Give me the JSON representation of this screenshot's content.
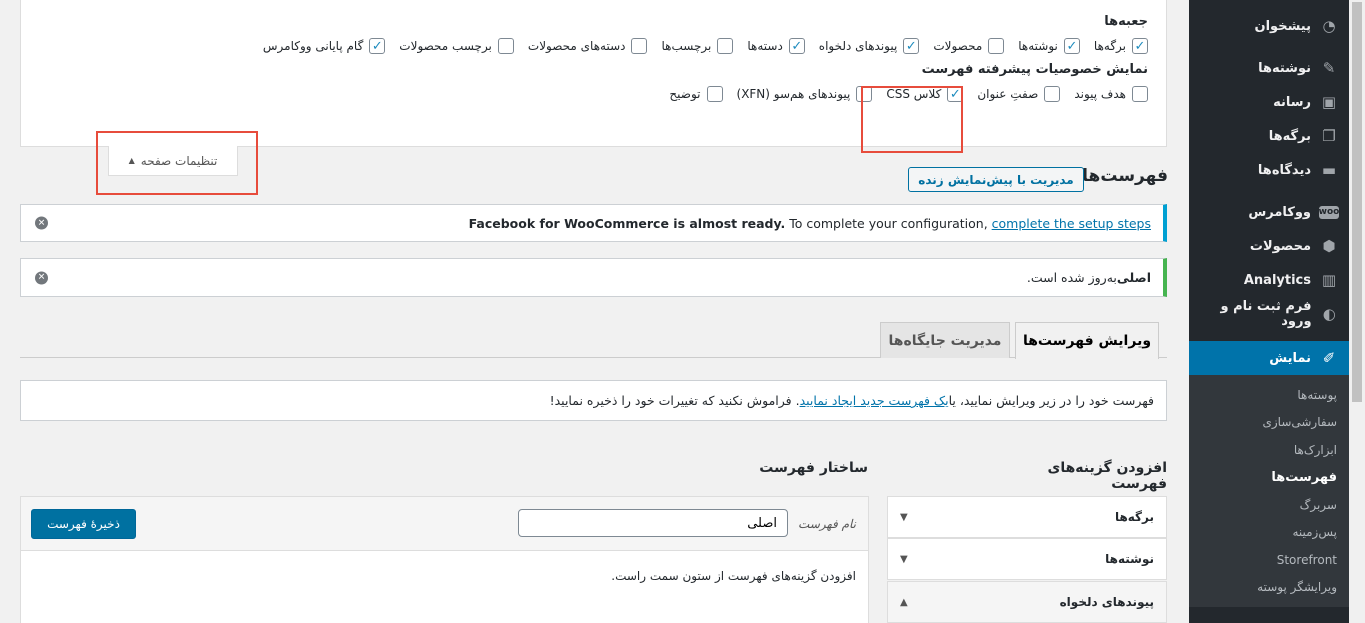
{
  "sidebar": {
    "items": [
      {
        "label": "پیشخوان",
        "icon": "dashboard-icon"
      },
      {
        "label": "نوشته‌ها",
        "icon": "pin-icon"
      },
      {
        "label": "رسانه",
        "icon": "media-icon"
      },
      {
        "label": "برگه‌ها",
        "icon": "pages-icon"
      },
      {
        "label": "دیدگاه‌ها",
        "icon": "comments-icon"
      },
      {
        "label": "ووکامرس",
        "icon": "woo-icon"
      },
      {
        "label": "محصولات",
        "icon": "products-icon"
      },
      {
        "label": "Analytics",
        "icon": "analytics-icon"
      },
      {
        "label": "فرم ثبت نام و ورود",
        "icon": "form-icon"
      },
      {
        "label": "نمایش",
        "icon": "appearance-icon"
      }
    ],
    "submenu": [
      "پوسته‌ها",
      "سفارشی‌سازی",
      "ابزارک‌ها",
      "فهرست‌ها",
      "سربرگ",
      "پس‌زمینه",
      "Storefront",
      "ویرایشگر پوسته"
    ]
  },
  "screen_options": {
    "boxes_heading": "جعبه‌ها",
    "boxes": [
      {
        "label": "برگه‌ها",
        "checked": true
      },
      {
        "label": "نوشته‌ها",
        "checked": true
      },
      {
        "label": "محصولات",
        "checked": false
      },
      {
        "label": "پیوندهای دلخواه",
        "checked": true
      },
      {
        "label": "دسته‌ها",
        "checked": true
      },
      {
        "label": "برچسب‌ها",
        "checked": false
      },
      {
        "label": "دسته‌های محصولات",
        "checked": false
      },
      {
        "label": "برچسب محصولات",
        "checked": false
      },
      {
        "label": "گام پایانی ووکامرس",
        "checked": true
      }
    ],
    "advanced_heading": "نمایش خصوصیات پیشرفته فهرست",
    "advanced": [
      {
        "label": "هدف پیوند",
        "checked": false
      },
      {
        "label": "صفتِ عنوان",
        "checked": false
      },
      {
        "label": "کلاس CSS",
        "checked": true
      },
      {
        "label": "پیوندهای هم‌سو (XFN)",
        "checked": false
      },
      {
        "label": "توضیح",
        "checked": false
      }
    ],
    "toggle_label": "تنظیمات صفحه",
    "toggle_arrow": "▲"
  },
  "header": {
    "title": "فهرست‌ها",
    "live_preview": "مدیریت با پیش‌نمایش زنده"
  },
  "notices": {
    "fb_bold": "Facebook for WooCommerce is almost ready.",
    "fb_text": " To complete your configuration, ",
    "fb_link": "complete the setup steps",
    "saved_bold": "اصلی",
    "saved_text": " به‌روز شده است."
  },
  "tabs": {
    "edit": "ویرایش فهرست‌ها",
    "locations": "مدیریت جایگاه‌ها"
  },
  "info": {
    "before": "فهرست خود را در زیر ویرایش نمایید، یا ",
    "link": "یک فهرست جدید ایجاد نمایید",
    "after": ". فراموش نکنید که تغییرات خود را ذخیره نمایید!"
  },
  "add_items": {
    "heading": "افزودن گزینه‌های فهرست",
    "items": [
      {
        "label": "برگه‌ها",
        "chev": "▼"
      },
      {
        "label": "نوشته‌ها",
        "chev": "▼"
      },
      {
        "label": "پیوندهای دلخواه",
        "chev": "▲"
      }
    ]
  },
  "structure": {
    "heading": "ساختار فهرست",
    "name_label": "نام فهرست",
    "name_value": "اصلی",
    "save": "ذخیرهٔ فهرست",
    "body": "افزودن گزینه‌های فهرست از ستون سمت راست."
  },
  "colors": {
    "accent": "#0073aa",
    "highlight": "#e74c3c"
  }
}
